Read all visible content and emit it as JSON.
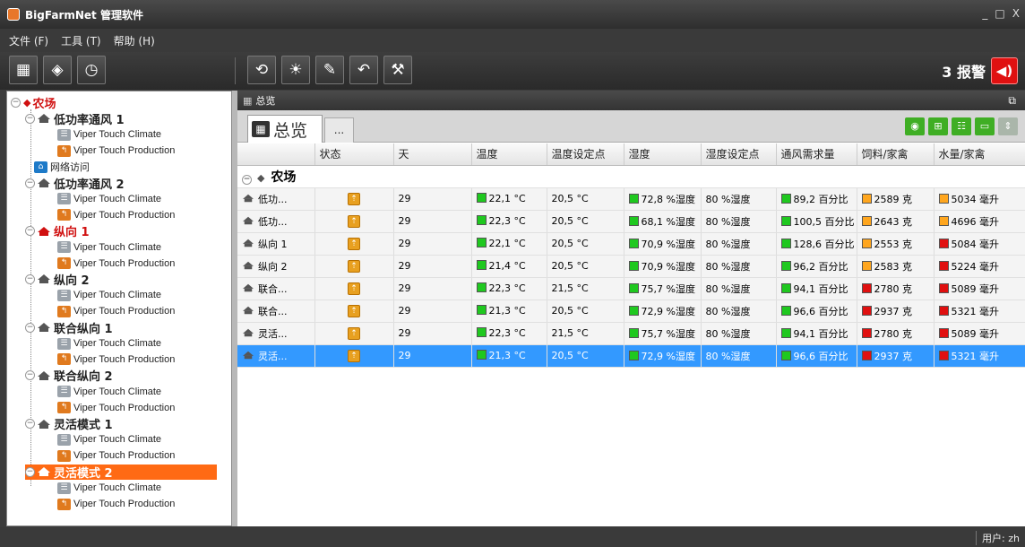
{
  "window": {
    "title": "BigFarmNet 管理软件",
    "minimize": "_",
    "maximize": "□",
    "close": "X"
  },
  "menu": {
    "items": [
      "文件 (F)",
      "工具 (T)",
      "帮助 (H)"
    ]
  },
  "toolbar": {
    "left_icons": [
      "grid-icon",
      "tag-icon",
      "timer-icon"
    ],
    "right_icons": [
      "history-icon",
      "weather-icon",
      "edit-icon",
      "back-arrow-icon",
      "tools-icon"
    ],
    "alarm_label": "3 报警"
  },
  "tree": {
    "farm": "农场",
    "houses": [
      {
        "name": "低功率通风 1",
        "devices": [
          "Viper Touch Climate",
          "Viper Touch Production"
        ]
      },
      {
        "name": "低功率通风 2",
        "devices": [
          "Viper Touch Climate",
          "Viper Touch Production"
        ]
      },
      {
        "name": "纵向 1",
        "devices": [
          "Viper Touch Climate",
          "Viper Touch Production"
        ]
      },
      {
        "name": "纵向 2",
        "devices": [
          "Viper Touch Climate",
          "Viper Touch Production"
        ]
      },
      {
        "name": "联合纵向 1",
        "devices": [
          "Viper Touch Climate",
          "Viper Touch Production"
        ]
      },
      {
        "name": "联合纵向 2",
        "devices": [
          "Viper Touch Climate",
          "Viper Touch Production"
        ]
      },
      {
        "name": "灵活模式 1",
        "devices": [
          "Viper Touch Climate",
          "Viper Touch Production"
        ]
      },
      {
        "name": "灵活模式 2",
        "devices": [
          "Viper Touch Climate",
          "Viper Touch Production"
        ]
      }
    ],
    "network_access": "网络访问",
    "selected_index": 7,
    "alarm_house_index": 2
  },
  "main": {
    "header_title": "总览",
    "tab_label": "总览",
    "tab_more": "...",
    "columns": [
      "",
      "状态",
      "天",
      "温度",
      "温度设定点",
      "湿度",
      "湿度设定点",
      "通风需求量",
      "饲料/家禽",
      "水量/家禽"
    ],
    "group_label": "农场",
    "rows": [
      {
        "name": "低功...",
        "day": "29",
        "temp": "22,1 °C",
        "temp_sp": "20,5 °C",
        "hum": "72,8 %湿度",
        "hum_sp": "80 %湿度",
        "vent": "89,2 百分比",
        "feed": "2589 克",
        "feed_color": "orange",
        "water": "5034 毫升",
        "water_color": "orange"
      },
      {
        "name": "低功...",
        "day": "29",
        "temp": "22,3 °C",
        "temp_sp": "20,5 °C",
        "hum": "68,1 %湿度",
        "hum_sp": "80 %湿度",
        "vent": "100,5 百分比",
        "feed": "2643 克",
        "feed_color": "orange",
        "water": "4696 毫升",
        "water_color": "orange"
      },
      {
        "name": "纵向 1",
        "day": "29",
        "temp": "22,1 °C",
        "temp_sp": "20,5 °C",
        "hum": "70,9 %湿度",
        "hum_sp": "80 %湿度",
        "vent": "128,6 百分比",
        "feed": "2553 克",
        "feed_color": "orange",
        "water": "5084 毫升",
        "water_color": "red"
      },
      {
        "name": "纵向 2",
        "day": "29",
        "temp": "21,4 °C",
        "temp_sp": "20,5 °C",
        "hum": "70,9 %湿度",
        "hum_sp": "80 %湿度",
        "vent": "96,2 百分比",
        "feed": "2583 克",
        "feed_color": "orange",
        "water": "5224 毫升",
        "water_color": "red"
      },
      {
        "name": "联合...",
        "day": "29",
        "temp": "22,3 °C",
        "temp_sp": "21,5 °C",
        "hum": "75,7 %湿度",
        "hum_sp": "80 %湿度",
        "vent": "94,1 百分比",
        "feed": "2780 克",
        "feed_color": "red",
        "water": "5089 毫升",
        "water_color": "red"
      },
      {
        "name": "联合...",
        "day": "29",
        "temp": "21,3 °C",
        "temp_sp": "20,5 °C",
        "hum": "72,9 %湿度",
        "hum_sp": "80 %湿度",
        "vent": "96,6 百分比",
        "feed": "2937 克",
        "feed_color": "red",
        "water": "5321 毫升",
        "water_color": "red"
      },
      {
        "name": "灵活...",
        "day": "29",
        "temp": "22,3 °C",
        "temp_sp": "21,5 °C",
        "hum": "75,7 %湿度",
        "hum_sp": "80 %湿度",
        "vent": "94,1 百分比",
        "feed": "2780 克",
        "feed_color": "red",
        "water": "5089 毫升",
        "water_color": "red"
      },
      {
        "name": "灵活...",
        "day": "29",
        "temp": "21,3 °C",
        "temp_sp": "20,5 °C",
        "hum": "72,9 %湿度",
        "hum_sp": "80 %湿度",
        "vent": "96,6 百分比",
        "feed": "2937 克",
        "feed_color": "red",
        "water": "5321 毫升",
        "water_color": "red"
      }
    ],
    "selected_row": 7
  },
  "status": {
    "user": "用户: zh"
  },
  "colors": {
    "accent_orange": "#ff6a14",
    "alarm_red": "#e01010",
    "selection_blue": "#3399ff",
    "ok_green": "#1fc81f"
  }
}
